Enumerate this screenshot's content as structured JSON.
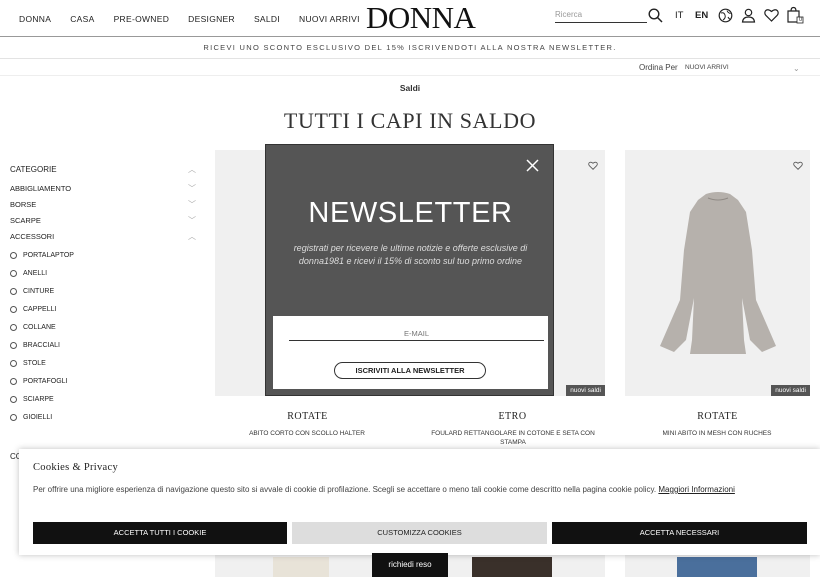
{
  "header": {
    "nav": [
      "DONNA",
      "CASA",
      "PRE-OWNED",
      "DESIGNER",
      "SALDI",
      "NUOVI ARRIVI"
    ],
    "logo": "DONNA",
    "search_placeholder": "Ricerca",
    "lang_it": "IT",
    "lang_en": "EN",
    "cart_count": "0"
  },
  "promo": "RICEVI UNO SCONTO ESCLUSIVO DEL 15% ISCRIVENDOTI ALLA NOSTRA NEWSLETTER.",
  "sort": {
    "label": "Ordina Per",
    "value": "NUOVI ARRIVI"
  },
  "breadcrumb": "Saldi",
  "page_title": "TUTTI I CAPI IN SALDO",
  "sidebar": {
    "title": "CATEGORIE",
    "categories": [
      "ABBIGLIAMENTO",
      "BORSE",
      "SCARPE",
      "ACCESSORI"
    ],
    "subcategories": [
      "PORTALAPTOP",
      "ANELLI",
      "CINTURE",
      "CAPPELLI",
      "COLLANE",
      "BRACCIALI",
      "STOLE",
      "PORTAFOGLI",
      "SCIARPE",
      "GIOIELLI"
    ],
    "next_label": "CO"
  },
  "products": [
    {
      "brand": "ROTATE",
      "name": "ABITO CORTO CON SCOLLO HALTER",
      "badge": ""
    },
    {
      "brand": "ETRO",
      "name": "FOULARD RETTANGOLARE IN COTONE E SETA CON STAMPA",
      "badge": "nuovi saldi"
    },
    {
      "brand": "ROTATE",
      "name": "MINI ABITO IN MESH CON RUCHES",
      "badge": "nuovi saldi"
    }
  ],
  "newsletter": {
    "title": "NEWSLETTER",
    "text": "registrati per ricevere le ultime notizie e offerte esclusive di donna1981 e ricevi il 15% di sconto sul tuo primo ordine",
    "email_placeholder": "E-MAIL",
    "button": "ISCRIVITI ALLA NEWSLETTER"
  },
  "cookie": {
    "title": "Cookies & Privacy",
    "text": "Per offrire una migliore esperienza di navigazione questo sito si avvale di cookie di profilazione. Scegli se accettare o meno tali cookie come descritto nella pagina cookie policy.",
    "link": "Maggiori Informazioni",
    "accept_all": "ACCETTA TUTTI I COOKIE",
    "customize": "CUSTOMIZZA COOKIES",
    "accept_necessary": "ACCETTA NECESSARI"
  },
  "return_button": "richiedi reso",
  "colors": {
    "popup_bg": "#555555",
    "dark_button": "#111111",
    "product_bg": "#f0f0f0",
    "badge_bg": "#555555"
  }
}
